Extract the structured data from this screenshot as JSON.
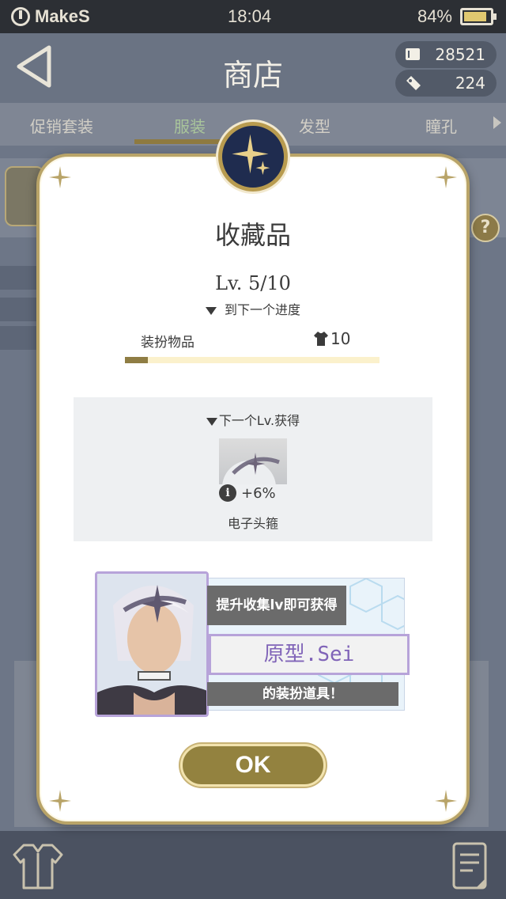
{
  "status_bar": {
    "carrier": "MakeS",
    "time": "18:04",
    "battery": "84%"
  },
  "header": {
    "title": "商店",
    "currency_primary": "28521",
    "currency_secondary": "224"
  },
  "tabs": [
    {
      "label": "促销套装"
    },
    {
      "label": "服装"
    },
    {
      "label": "发型"
    },
    {
      "label": "瞳孔"
    }
  ],
  "modal": {
    "title": "收藏品",
    "level": "Lv. 5/10",
    "next_progress": "到下一个进度",
    "progress_label": "装扮物品",
    "progress_count": "10",
    "progress_fraction": 0.09,
    "reward_heading": "下一个Lv.获得",
    "reward_bonus": "+6%",
    "reward_name": "电子头箍",
    "promo_line1": "提升收集lv即可获得",
    "promo_name": "原型.Sei",
    "promo_line2": "的装扮道具！",
    "ok_label": "OK"
  },
  "colors": {
    "accent_gold": "#93823f",
    "modal_border": "#b9a468",
    "promo_purple": "#8064b8",
    "tab_active": "#a9c59b"
  }
}
